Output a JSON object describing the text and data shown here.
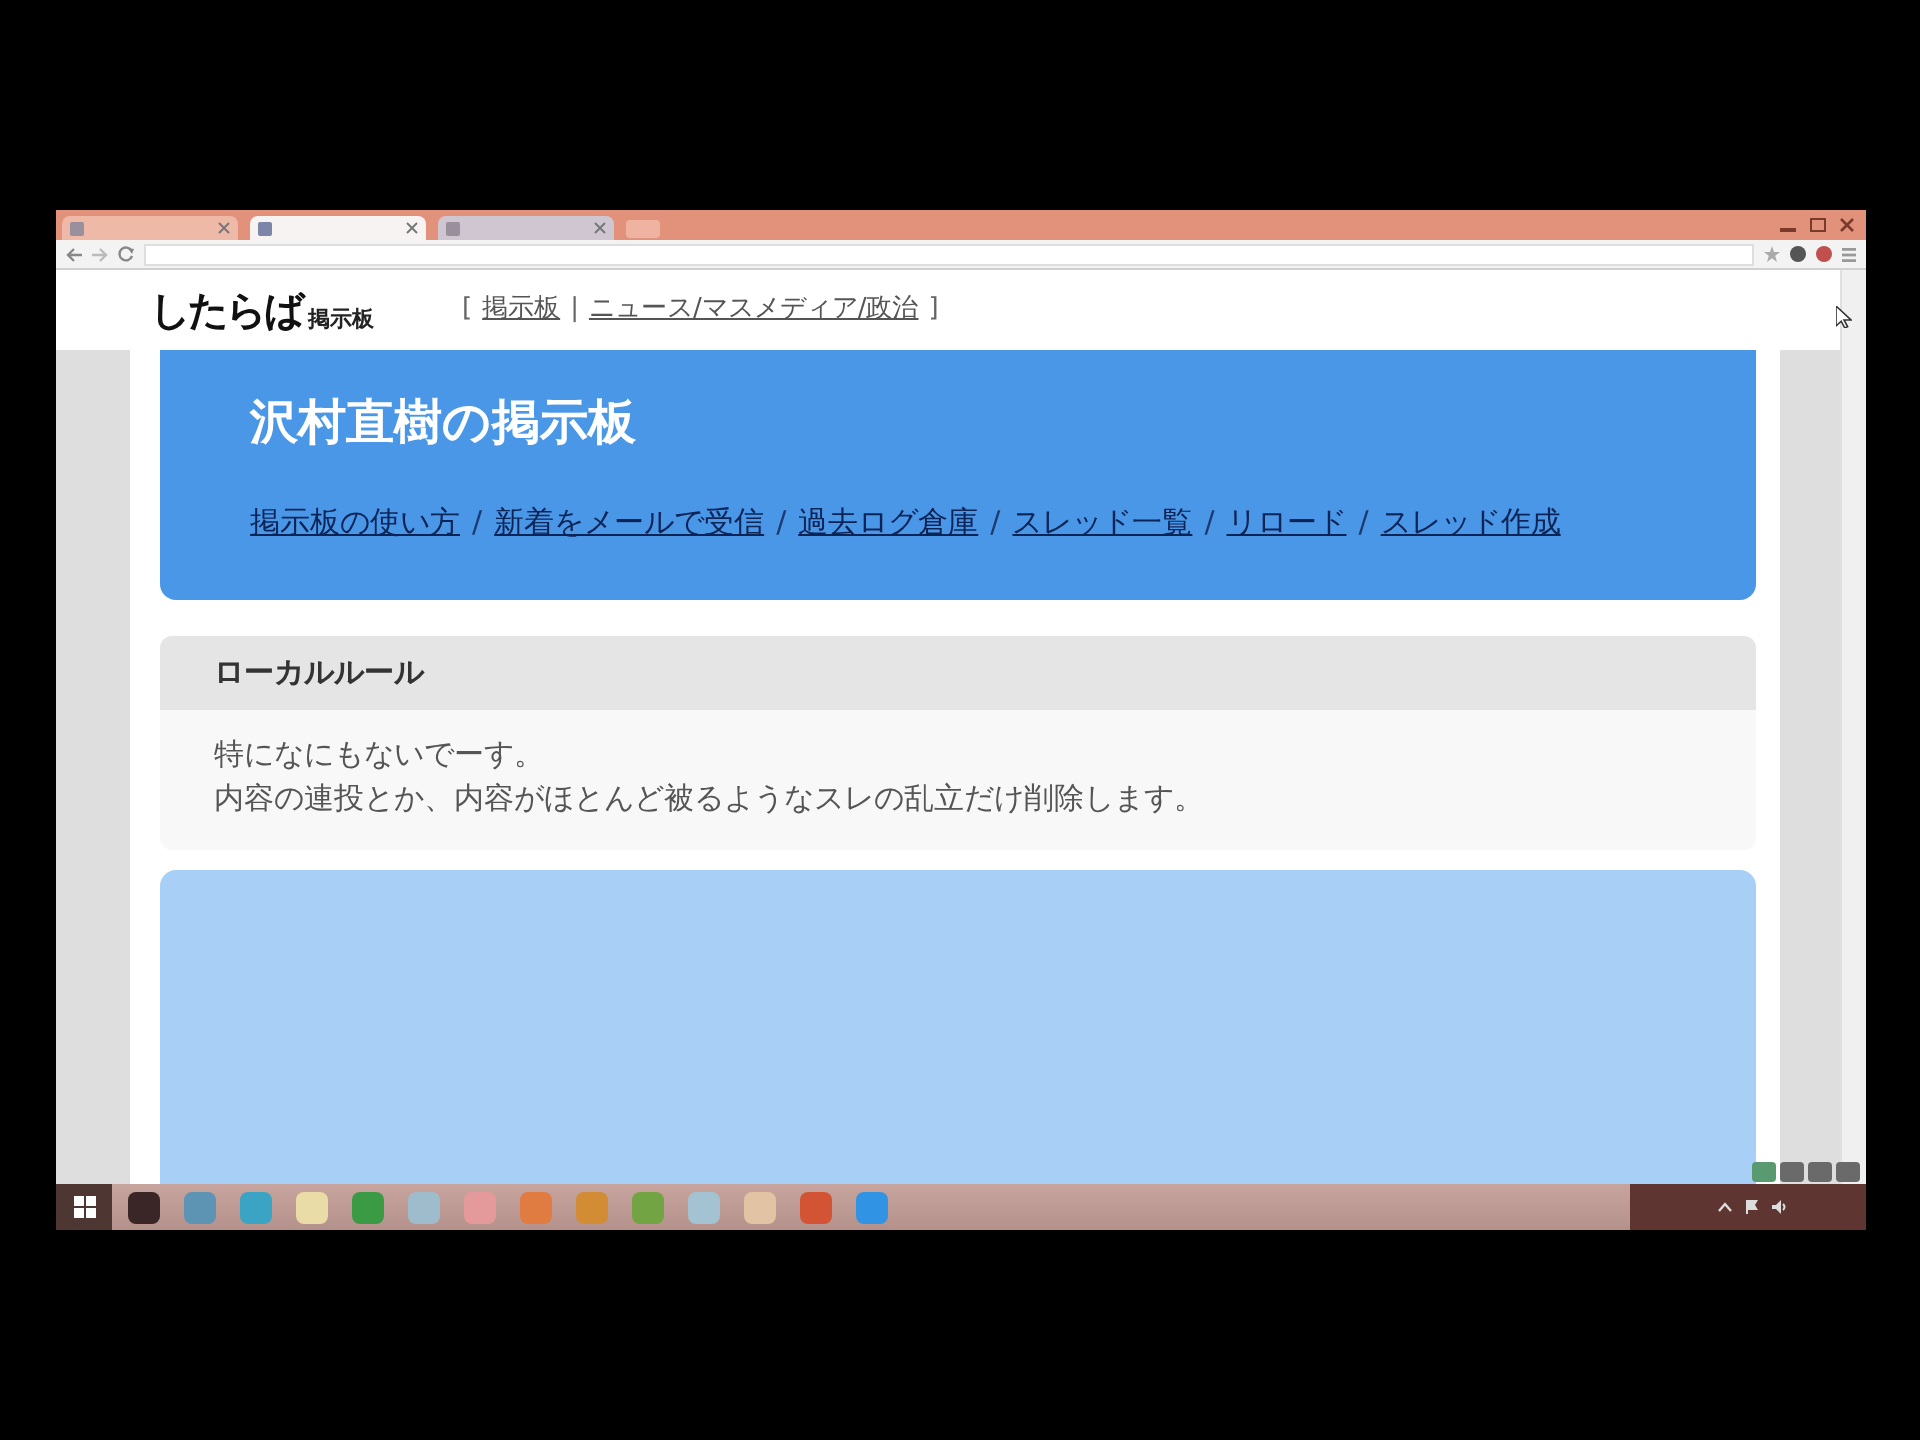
{
  "browser": {
    "tabs": [
      {
        "selected": false
      },
      {
        "selected": true
      },
      {
        "selected": false
      }
    ]
  },
  "site_header": {
    "logo": {
      "wordmark": "したらば",
      "tagline": "掲示板"
    },
    "breadcrumb": [
      {
        "kind": "bracket",
        "text": "["
      },
      {
        "kind": "link",
        "text": "掲示板"
      },
      {
        "kind": "separator",
        "text": "|"
      },
      {
        "kind": "link",
        "text": "ニュース/マスメディア/政治"
      },
      {
        "kind": "bracket",
        "text": "]"
      }
    ]
  },
  "board": {
    "title": "沢村直樹の掲示板",
    "nav": [
      {
        "kind": "link",
        "text": "掲示板の使い方"
      },
      {
        "kind": "separator",
        "text": "/"
      },
      {
        "kind": "link",
        "text": "新着をメールで受信"
      },
      {
        "kind": "separator",
        "text": "/"
      },
      {
        "kind": "link",
        "text": "過去ログ倉庫"
      },
      {
        "kind": "separator",
        "text": "/"
      },
      {
        "kind": "link",
        "text": "スレッド一覧"
      },
      {
        "kind": "separator",
        "text": "/"
      },
      {
        "kind": "link",
        "text": "リロード"
      },
      {
        "kind": "separator",
        "text": "/"
      },
      {
        "kind": "link",
        "text": "スレッド作成"
      }
    ]
  },
  "local_rule": {
    "title": "ローカルルール",
    "lines": [
      "特になにもないでーす。",
      "内容の連投とか、内容がほとんど被るようなスレの乱立だけ削除します。"
    ]
  }
}
